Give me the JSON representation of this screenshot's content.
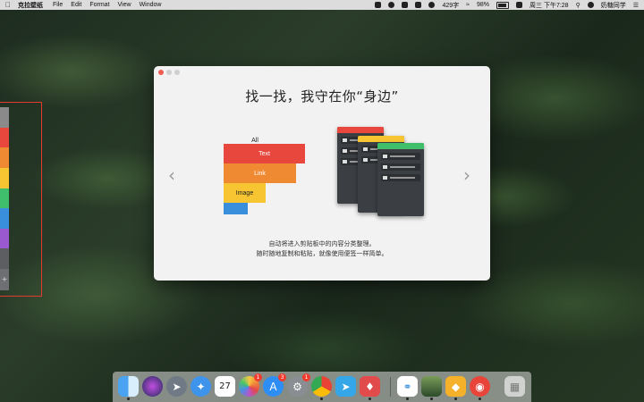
{
  "menubar": {
    "app_name": "克拉壁纸",
    "menus": [
      "File",
      "Edit",
      "Format",
      "View",
      "Window"
    ],
    "status_text": "429字",
    "battery": "98%",
    "datetime": "周三 下午7:28",
    "user": "奶糖同学"
  },
  "window": {
    "title": "找一找，我守在你“身边”",
    "categories": [
      {
        "label": "All",
        "color": "#f2f2f2"
      },
      {
        "label": "Text",
        "color": "#e8473d"
      },
      {
        "label": "Link",
        "color": "#ef8a33"
      },
      {
        "label": "Image",
        "color": "#f6c531"
      },
      {
        "label": "",
        "color": "#3a8fdc"
      }
    ],
    "description_line1": "自动将进入剪贴板中的内容分类整理。",
    "description_line2": "随时随地复制和粘贴，就像使用便签一样简单。"
  },
  "sidebar": {
    "colors": [
      "#8a8a8a",
      "#e8473d",
      "#ef8a33",
      "#f6c531",
      "#3fbf6b",
      "#3a8fdc",
      "#9b59d0",
      "#6a6a6a"
    ],
    "plus": "+"
  },
  "colors": {
    "red": "#e8473d",
    "orange": "#ef8a33",
    "yellow": "#f6c531",
    "green": "#3fbf6b",
    "blue": "#3a8fdc"
  },
  "dock": {
    "badges": {
      "appstore": "3",
      "settings": "1",
      "calendar_date": "27"
    }
  }
}
